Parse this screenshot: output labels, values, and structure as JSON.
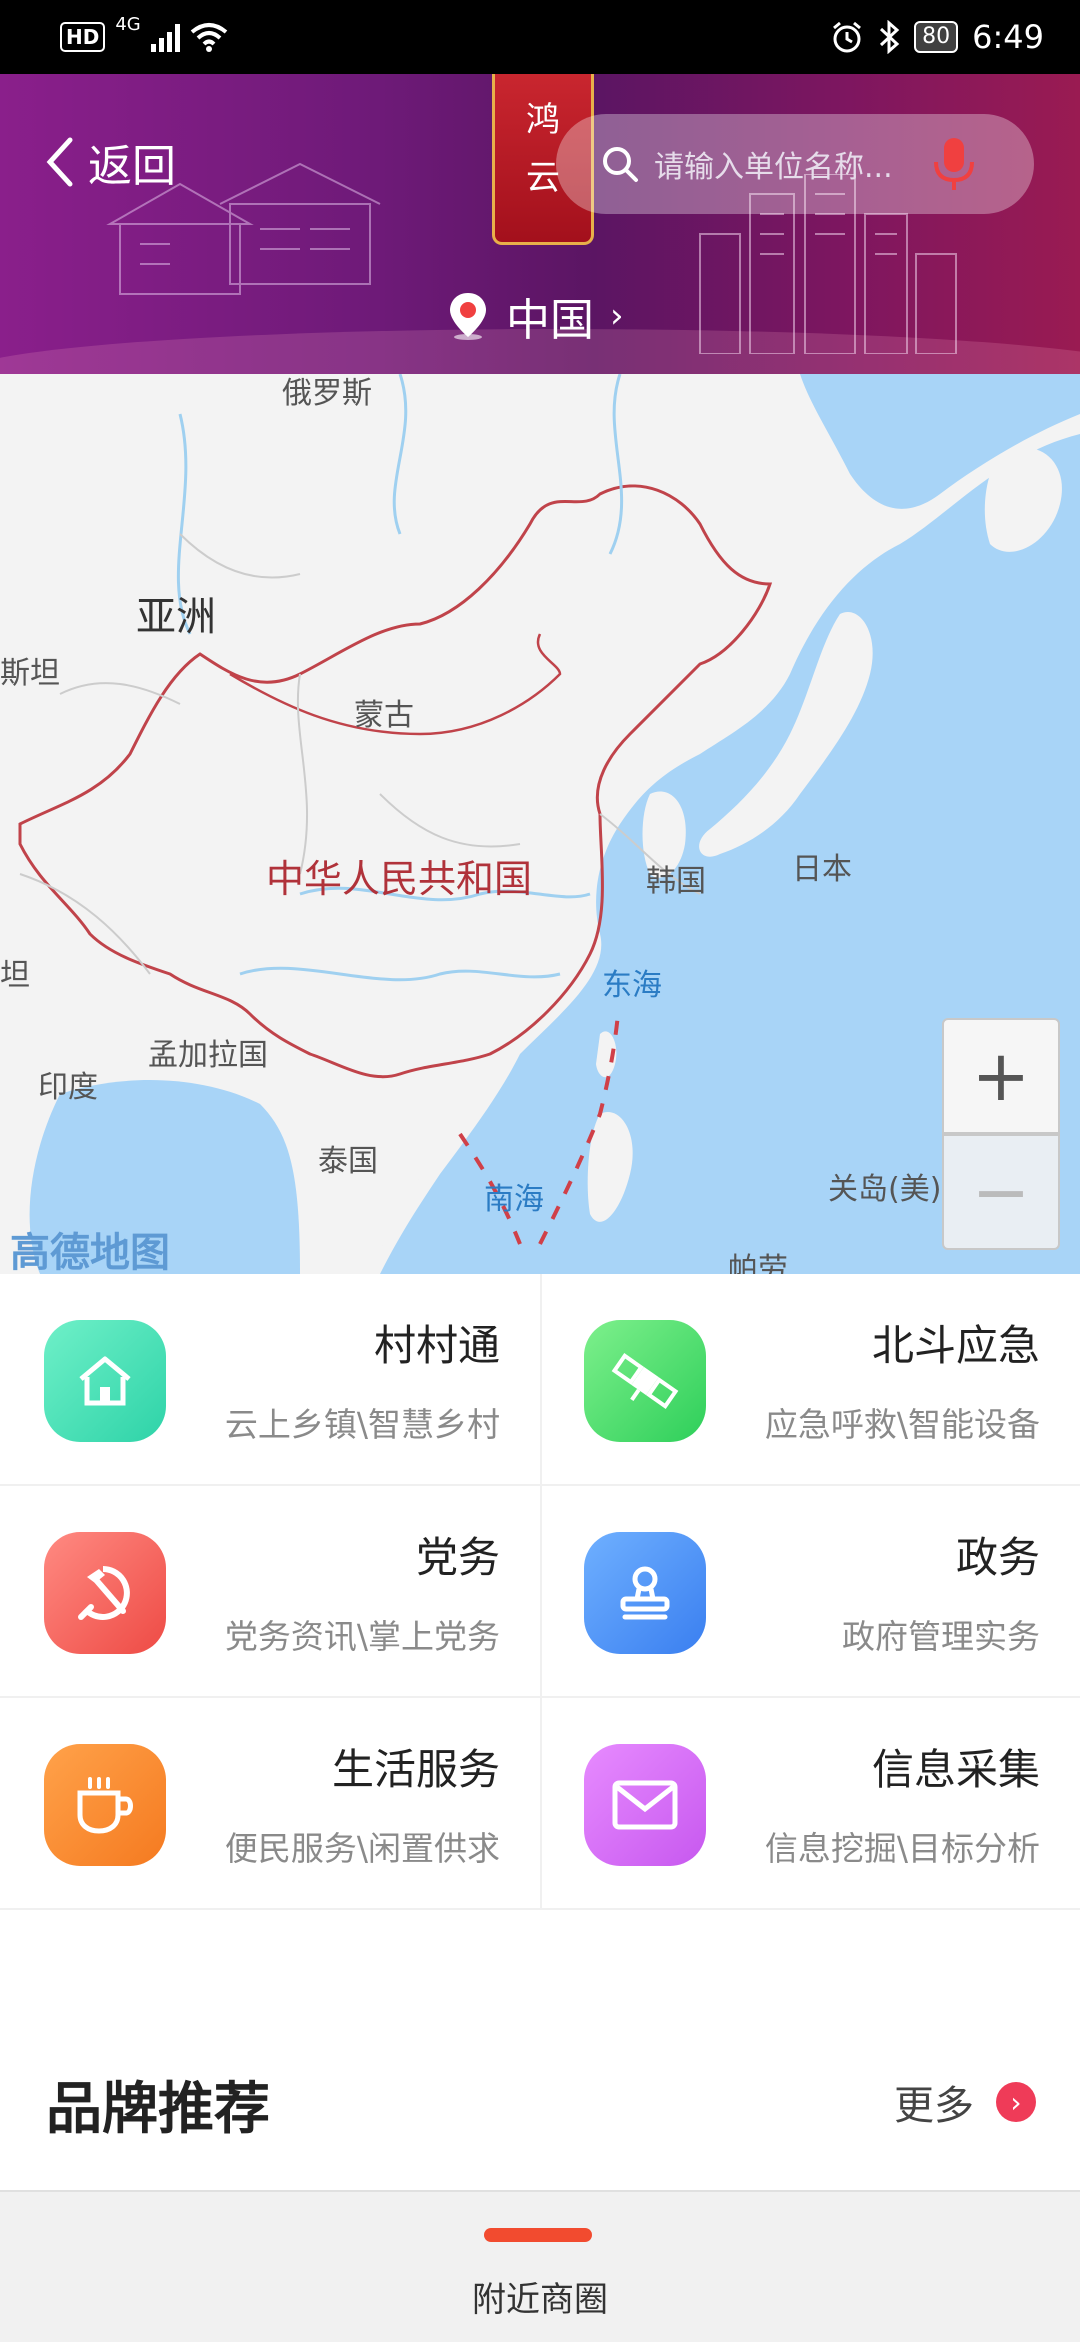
{
  "status_bar": {
    "hd_badge": "HD",
    "network": "4G",
    "battery": "80",
    "time": "6:49"
  },
  "header": {
    "back_label": "返回",
    "seal_chars": [
      "鸿",
      "云"
    ],
    "search_placeholder": "请输入单位名称...",
    "location": "中国"
  },
  "map": {
    "labels": {
      "russia": "俄罗斯",
      "asia": "亚洲",
      "stan_left": "斯坦",
      "mongolia": "蒙古",
      "china": "中华人民共和国",
      "korea": "韩国",
      "japan": "日本",
      "east_sea": "东海",
      "tan_left": "坦",
      "bangladesh": "孟加拉国",
      "india": "印度",
      "thailand": "泰国",
      "south_sea": "南海",
      "guam": "关岛(美)",
      "palau": "帕劳"
    },
    "zoom_in": "+",
    "zoom_out": "−",
    "provider_logo": "高德地图"
  },
  "services": [
    {
      "title": "村村通",
      "subtitle": "云上乡镇\\智慧乡村",
      "icon": "house-icon",
      "color_from": "#6ff0c8",
      "color_to": "#2ed3a8"
    },
    {
      "title": "北斗应急",
      "subtitle": "应急呼救\\智能设备",
      "icon": "satellite-icon",
      "color_from": "#7ef08c",
      "color_to": "#2ecf5a"
    },
    {
      "title": "党务",
      "subtitle": "党务资讯\\掌上党务",
      "icon": "hammer-sickle-icon",
      "color_from": "#ff8a82",
      "color_to": "#ee4b45"
    },
    {
      "title": "政务",
      "subtitle": "政府管理实务",
      "icon": "stamp-icon",
      "color_from": "#6fb0ff",
      "color_to": "#3a7ff0"
    },
    {
      "title": "生活服务",
      "subtitle": "便民服务\\闲置供求",
      "icon": "coffee-cup-icon",
      "color_from": "#ffa24a",
      "color_to": "#f57a20"
    },
    {
      "title": "信息采集",
      "subtitle": "信息挖掘\\目标分析",
      "icon": "envelope-icon",
      "color_from": "#e78bff",
      "color_to": "#c758ef"
    }
  ],
  "brand": {
    "title": "品牌推荐",
    "more_label": "更多"
  },
  "bottom_nav": {
    "label": "附近商圈",
    "accent": "#f24b2f"
  }
}
